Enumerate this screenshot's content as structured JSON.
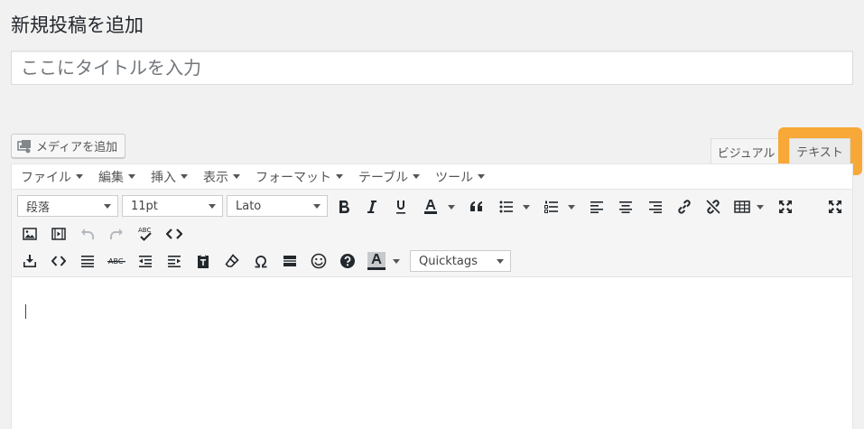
{
  "page": {
    "title": "新規投稿を追加"
  },
  "title_field": {
    "value": "",
    "placeholder": "ここにタイトルを入力"
  },
  "media_button": {
    "label": "メディアを追加"
  },
  "editor_tabs": [
    {
      "label": "ビジュアル",
      "active": false
    },
    {
      "label": "テキスト",
      "active": true,
      "highlight_color": "#f7a836"
    }
  ],
  "menubar": [
    {
      "label": "ファイル"
    },
    {
      "label": "編集"
    },
    {
      "label": "挿入"
    },
    {
      "label": "表示"
    },
    {
      "label": "フォーマット"
    },
    {
      "label": "テーブル"
    },
    {
      "label": "ツール"
    }
  ],
  "toolbar": {
    "paragraph_select": "段落",
    "font_size_select": "11pt",
    "font_family_select": "Lato",
    "quicktags_select": "Quicktags",
    "row1_icons": [
      "bold-icon",
      "italic-icon",
      "underline-icon",
      "text-color-icon",
      "blockquote-icon",
      "bullet-list-icon",
      "numbered-list-icon",
      "align-left-icon",
      "align-center-icon",
      "align-right-icon",
      "link-icon",
      "unlink-icon",
      "table-icon",
      "fullscreen-icon",
      "distraction-free-icon"
    ],
    "row2_icons": [
      "image-icon",
      "media-icon",
      "undo-icon",
      "redo-icon",
      "spellcheck-icon",
      "code-icon"
    ],
    "row3_icons": [
      "insert-more-icon",
      "code-tag-icon",
      "justify-icon",
      "strikethrough-icon",
      "outdent-icon",
      "indent-icon",
      "paste-text-icon",
      "clear-format-icon",
      "omega-icon",
      "page-break-icon",
      "emoji-icon",
      "help-icon",
      "background-color-icon"
    ],
    "spellcheck_label": "ABC",
    "strikethrough_label": "ABC"
  },
  "colors": {
    "background": "#f1f1f1",
    "highlight": "#f7a836"
  }
}
